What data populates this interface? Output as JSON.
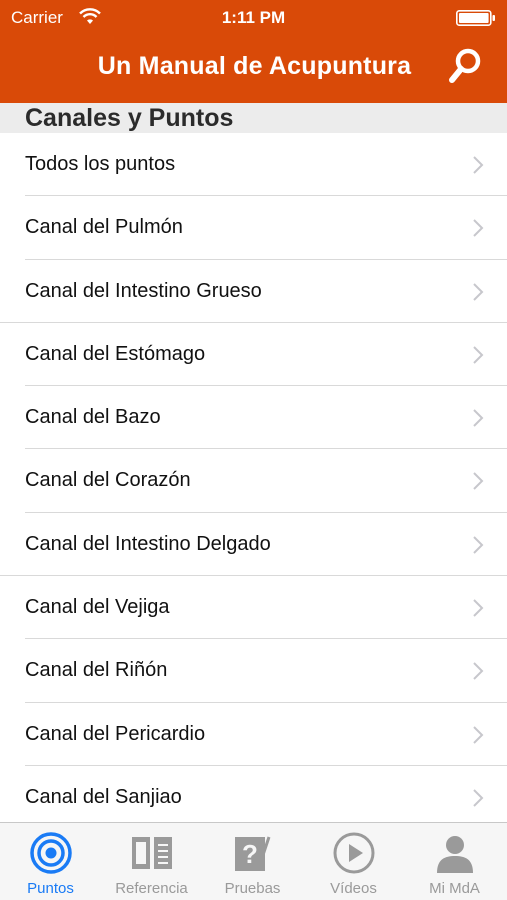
{
  "status_bar": {
    "carrier": "Carrier",
    "time": "1:11 PM"
  },
  "nav": {
    "title": "Un Manual de Acupuntura",
    "search_icon": "search-icon"
  },
  "section": {
    "title": "Canales y Puntos"
  },
  "list_items": [
    {
      "label": "Todos los puntos"
    },
    {
      "label": "Canal del Pulmón"
    },
    {
      "label": "Canal del Intestino Grueso"
    },
    {
      "label": "Canal del Estómago"
    },
    {
      "label": "Canal del Bazo"
    },
    {
      "label": "Canal del Corazón"
    },
    {
      "label": "Canal del Intestino Delgado"
    },
    {
      "label": "Canal del Vejiga"
    },
    {
      "label": "Canal del Riñón"
    },
    {
      "label": "Canal del Pericardio"
    },
    {
      "label": "Canal del Sanjiao"
    }
  ],
  "tabs": [
    {
      "label": "Puntos",
      "icon": "target-icon",
      "active": true
    },
    {
      "label": "Referencia",
      "icon": "book-icon",
      "active": false
    },
    {
      "label": "Pruebas",
      "icon": "quiz-icon",
      "active": false
    },
    {
      "label": "Vídeos",
      "icon": "play-icon",
      "active": false
    },
    {
      "label": "Mi MdA",
      "icon": "person-icon",
      "active": false
    }
  ],
  "colors": {
    "header": "#d94a08",
    "tab_active": "#1a7bf5",
    "tab_inactive": "#9a9a9a"
  }
}
